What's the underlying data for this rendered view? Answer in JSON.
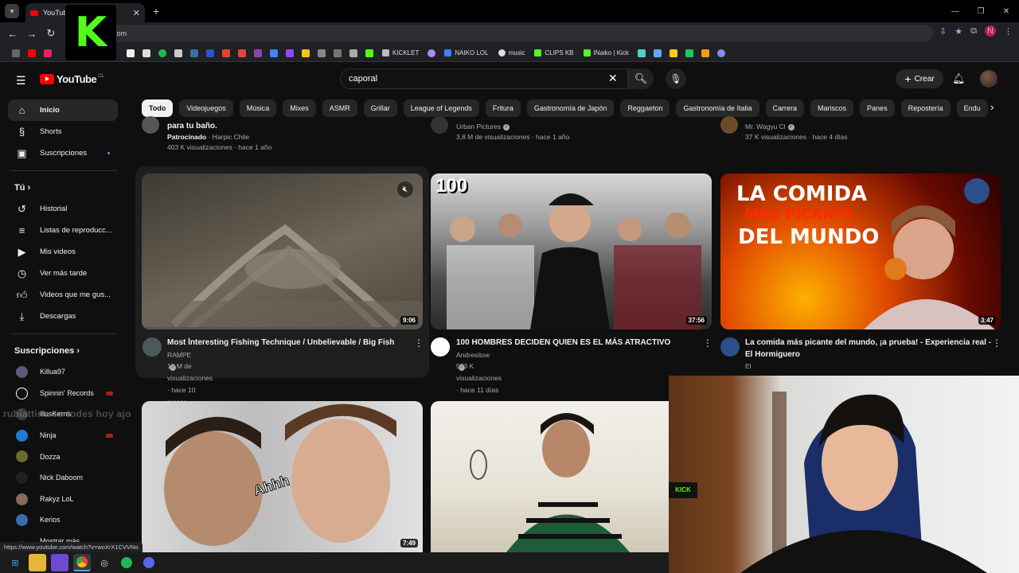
{
  "browser": {
    "tab_title": "YouTube",
    "tab_close": "✕",
    "new_tab": "+",
    "omnibox_text": "com",
    "profile_letter": "N"
  },
  "bookmarks": {
    "labeled": [
      "KICKLET",
      "NAIKO LOL",
      "music",
      "CLIPS KB",
      "INaiko | Kick"
    ]
  },
  "kick_logo": "K",
  "masthead": {
    "logo_text": "YouTube",
    "logo_country": "CL",
    "search_value": "caporal",
    "create_label": "Crear"
  },
  "sidebar": {
    "main": [
      {
        "label": "Inicio",
        "icon": "home-icon"
      },
      {
        "label": "Shorts",
        "icon": "shorts-icon"
      },
      {
        "label": "Suscripciones",
        "icon": "subscriptions-icon"
      }
    ],
    "you_header": "Tú",
    "you": [
      {
        "label": "Historial",
        "icon": "history-icon"
      },
      {
        "label": "Listas de reproducc...",
        "icon": "playlists-icon"
      },
      {
        "label": "Mis videos",
        "icon": "my-videos-icon"
      },
      {
        "label": "Ver más tarde",
        "icon": "watch-later-icon"
      },
      {
        "label": "Videos que me gus...",
        "icon": "liked-icon"
      },
      {
        "label": "Descargas",
        "icon": "downloads-icon"
      }
    ],
    "subs_header": "Suscripciones",
    "subs": [
      {
        "label": "Killua97",
        "color": "#5a5a7a"
      },
      {
        "label": "Spinnin' Records",
        "color": "#111111"
      },
      {
        "label": "illusKerns",
        "color": "#3a3a3a"
      },
      {
        "label": "Ninja",
        "color": "#1f7ad6"
      },
      {
        "label": "Dozza",
        "color": "#6b6b2a"
      },
      {
        "label": "Nick Daboom",
        "color": "#202020"
      },
      {
        "label": "Rakyz LoL",
        "color": "#8a6a5a"
      },
      {
        "label": "Kerios",
        "color": "#3a6ab0"
      }
    ],
    "show_more": "Mostrar más"
  },
  "chips": [
    "Todo",
    "Videojuegos",
    "Música",
    "Mixes",
    "ASMR",
    "Grillar",
    "League of Legends",
    "Fritura",
    "Gastronomía de Japón",
    "Reggaeton",
    "Gastronomía de Italia",
    "Carrera",
    "Mariscos",
    "Panes",
    "Repostería",
    "Endu"
  ],
  "top_row": [
    {
      "title": "para tu baño.",
      "channel": "Patrocinado",
      "channel_suffix": " · Harpic Chile",
      "meta": "403 K visualizaciones · hace 1 año"
    },
    {
      "channel": "Urban Pictures",
      "meta": "3,8 M de visualizaciones · hace 1 año"
    },
    {
      "channel": "Mr. Wagyu Cl",
      "meta": "37 K visualizaciones · hace 4 días"
    }
  ],
  "videos": [
    {
      "title": "Most İnteresting Fishing Technique / Unbelievable / Big Fish",
      "channel": "RAMPE",
      "meta": "18 M de visualizaciones · hace 10 meses",
      "duration": "9:06"
    },
    {
      "title": "100 HOMBRES DECIDEN QUIEN ES EL MÁS ATRACTIVO",
      "channel": "Andresitow",
      "meta": "573 K visualizaciones · hace 11 días",
      "duration": "37:56",
      "thumb_text": "100"
    },
    {
      "title": "La comida más picante del mundo, ¡a prueba! - Experiencia real - El Hormiguero",
      "channel": "El Hormiguero",
      "meta": "",
      "duration": "3:47",
      "thumb_line1": "LA COMIDA",
      "thumb_line2": "MÁS PICANTE",
      "thumb_line3": "DEL MUNDO"
    },
    {
      "duration": "7:49",
      "thumb_text": "Ahhh"
    },
    {}
  ],
  "chat_overlay": "rubiattina en todes hoy ajo",
  "status_url": "https://www.youtube.com/watch?v=woXrX1CVVNo",
  "webcam_tag": "KICK"
}
